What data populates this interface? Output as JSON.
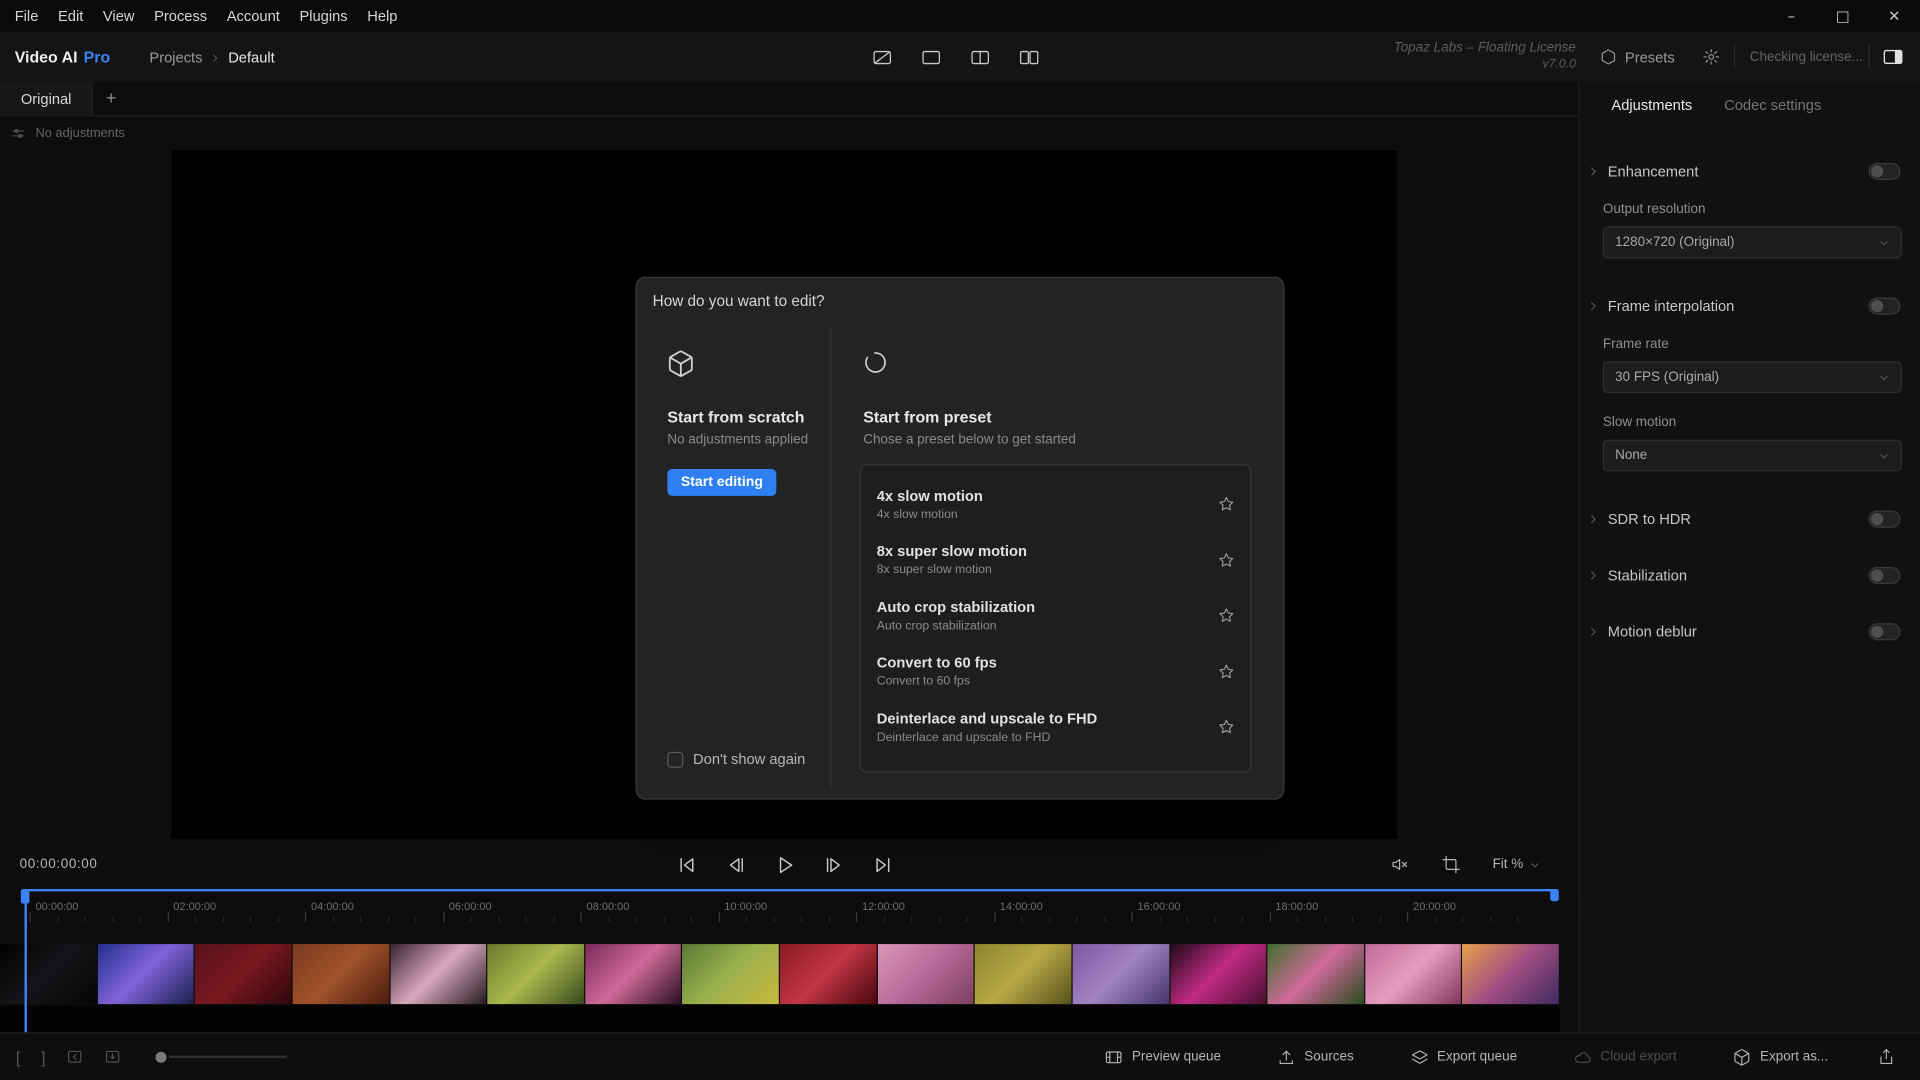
{
  "window": {
    "menu_items": [
      "File",
      "Edit",
      "View",
      "Process",
      "Account",
      "Plugins",
      "Help"
    ],
    "controls": {
      "minimize": "–",
      "restore": "□",
      "close": "✕"
    }
  },
  "header": {
    "app_name": "Video AI",
    "app_badge": "Pro",
    "breadcrumb": {
      "root": "Projects",
      "current": "Default"
    },
    "license_owner": "Topaz Labs – Floating License",
    "license_version": "v7.0.0",
    "presets_label": "Presets",
    "license_status": "Checking license...",
    "accent_color": "#3b82f6"
  },
  "preview": {
    "tab": "Original",
    "add_tab": "+",
    "note": "No adjustments"
  },
  "dialog": {
    "title": "How do you want to edit?",
    "scratch": {
      "title": "Start from scratch",
      "subtitle": "No adjustments applied",
      "button_label": "Start editing",
      "dont_show_label": "Don't show again",
      "checkbox_checked": false
    },
    "preset": {
      "title": "Start from preset",
      "subtitle": "Chose a preset below to get started",
      "items": [
        {
          "title": "4x slow motion",
          "subtitle": "4x slow motion"
        },
        {
          "title": "8x super slow motion",
          "subtitle": "8x super slow motion"
        },
        {
          "title": "Auto crop stabilization",
          "subtitle": "Auto crop stabilization"
        },
        {
          "title": "Convert to 60 fps",
          "subtitle": "Convert to 60 fps"
        },
        {
          "title": "Deinterlace and upscale to FHD",
          "subtitle": "Deinterlace and upscale to FHD"
        }
      ]
    }
  },
  "sidebar": {
    "tabs": [
      {
        "label": "Adjustments",
        "active": true
      },
      {
        "label": "Codec settings",
        "active": false
      }
    ],
    "items": [
      {
        "type": "toggle",
        "label": "Enhancement",
        "on": false
      },
      {
        "type": "dropdown",
        "label": "Output resolution",
        "value": "1280×720 (Original)"
      },
      {
        "type": "toggle",
        "label": "Frame interpolation",
        "on": false
      },
      {
        "type": "dropdown",
        "label": "Frame rate",
        "value": "30 FPS (Original)"
      },
      {
        "type": "dropdown",
        "label": "Slow motion",
        "value": "None"
      },
      {
        "type": "toggle",
        "label": "SDR to HDR",
        "on": false
      },
      {
        "type": "toggle",
        "label": "Stabilization",
        "on": false
      },
      {
        "type": "toggle",
        "label": "Motion deblur",
        "on": false
      }
    ]
  },
  "playback": {
    "timecode": "00:00:00:00",
    "fit_label": "Fit %"
  },
  "timeline": {
    "playhead_color": "#3b82f6",
    "ruler_labels": [
      "00:00:00",
      "02:00:00",
      "04:00:00",
      "06:00:00",
      "08:00:00",
      "10:00:00",
      "12:00:00",
      "14:00:00",
      "16:00:00",
      "18:00:00",
      "20:00:00"
    ],
    "thumbnails": [
      {
        "name": "dark",
        "colors": [
          "#000000",
          "#16161a",
          "#050505"
        ]
      },
      {
        "name": "blue-purple",
        "colors": [
          "#23308f",
          "#8063d8",
          "#1a1f4e"
        ]
      },
      {
        "name": "dark-red",
        "colors": [
          "#55101a",
          "#7a1820",
          "#2e080c"
        ]
      },
      {
        "name": "rust-speckle",
        "colors": [
          "#7a3a20",
          "#a0522a",
          "#4a1c10"
        ]
      },
      {
        "name": "pink-blossom",
        "colors": [
          "#3a2430",
          "#d9a8bc",
          "#241a20"
        ]
      },
      {
        "name": "green-yellow",
        "colors": [
          "#6b7a2a",
          "#aab84e",
          "#39481c"
        ]
      },
      {
        "name": "pink-flowers",
        "colors": [
          "#7a2a5a",
          "#d06a9a",
          "#2a1020"
        ]
      },
      {
        "name": "green-field",
        "colors": [
          "#5a7a35",
          "#9ab04e",
          "#c9b93d"
        ]
      },
      {
        "name": "red-roses",
        "colors": [
          "#8a1a22",
          "#c23545",
          "#49070e"
        ]
      },
      {
        "name": "blossom-tree",
        "colors": [
          "#d998b8",
          "#b86a98",
          "#7a4060"
        ]
      },
      {
        "name": "olive",
        "colors": [
          "#8a8530",
          "#b8a845",
          "#55511c"
        ]
      },
      {
        "name": "lavender-rows",
        "colors": [
          "#7a5a9e",
          "#a184c4",
          "#463468"
        ]
      },
      {
        "name": "magenta-dahlia",
        "colors": [
          "#200a18",
          "#c02a84",
          "#47102e"
        ]
      },
      {
        "name": "green-pink",
        "colors": [
          "#3f6f2c",
          "#d06a9a",
          "#2a4a1e"
        ]
      },
      {
        "name": "pink-bright",
        "colors": [
          "#c06a9a",
          "#e59cbc",
          "#84365e"
        ]
      },
      {
        "name": "sunset",
        "colors": [
          "#e8a048",
          "#a44f82",
          "#3e2a60"
        ]
      }
    ]
  },
  "footer": {
    "trim_in": "[",
    "trim_out": "]",
    "buttons": [
      {
        "label": "Preview queue",
        "icon": "film-icon",
        "enabled": true
      },
      {
        "label": "Sources",
        "icon": "upload-icon",
        "enabled": true
      },
      {
        "label": "Export queue",
        "icon": "layers-icon",
        "enabled": true
      },
      {
        "label": "Cloud export",
        "icon": "cloud-icon",
        "enabled": false
      },
      {
        "label": "Export as...",
        "icon": "box-icon",
        "enabled": true
      }
    ]
  },
  "icons": {
    "header": [
      "view-split-icon",
      "view-single-icon",
      "view-compare-icon",
      "view-dual-icon",
      "hexagon-presets-icon",
      "gear-icon",
      "panel-right-icon",
      "chevron-right-icon"
    ],
    "dialog": [
      "box-icon",
      "preset-circle-icon",
      "star-icon"
    ],
    "transport": [
      "skip-start-icon",
      "step-back-icon",
      "play-icon",
      "step-forward-icon",
      "skip-end-icon",
      "mute-icon",
      "crop-icon",
      "chevron-down-icon"
    ],
    "footer": [
      "marker-in-icon",
      "save-frame-icon",
      "film-icon",
      "upload-icon",
      "layers-icon",
      "cloud-icon",
      "box-icon",
      "share-icon"
    ],
    "misc": [
      "adjustments-icon"
    ]
  }
}
